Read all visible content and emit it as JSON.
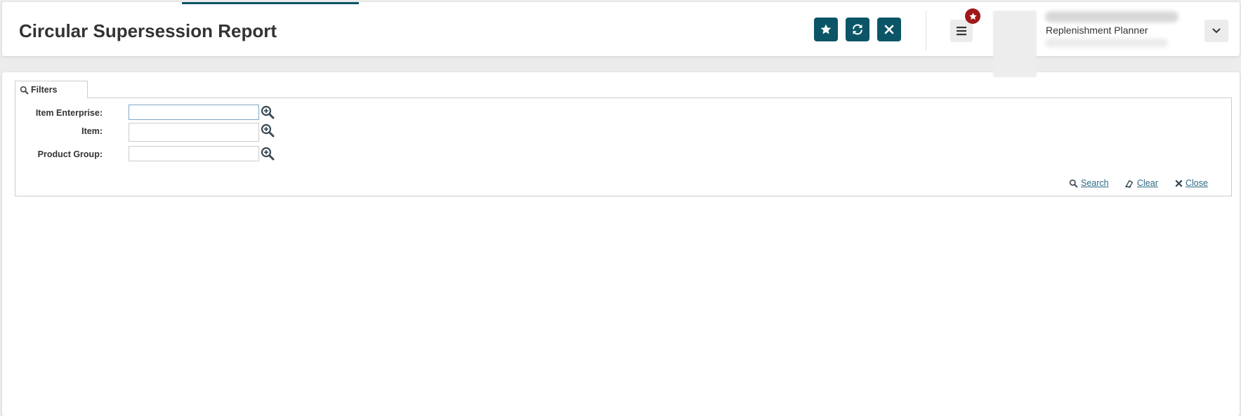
{
  "header": {
    "title": "Circular Supersession Report",
    "buttons": [
      {
        "name": "favorite-button",
        "icon": "star-icon"
      },
      {
        "name": "refresh-button",
        "icon": "refresh-icon"
      },
      {
        "name": "close-page-button",
        "icon": "x-icon"
      }
    ],
    "menu_icon": "hamburger-menu-icon",
    "notification_icon": "star-badge-icon",
    "user": {
      "role": "Replenishment Planner"
    },
    "accent_color": "#0b5566",
    "badge_color": "#a01818"
  },
  "filters": {
    "tab_label": "Filters",
    "fields": [
      {
        "label": "Item Enterprise:",
        "value": "",
        "placeholder": ""
      },
      {
        "label": "Item:",
        "value": "",
        "placeholder": ""
      },
      {
        "label": "Product Group:",
        "value": "",
        "placeholder": ""
      }
    ],
    "actions": {
      "search": "Search",
      "clear": "Clear",
      "close": "Close"
    },
    "link_color": "#2c6a85"
  }
}
